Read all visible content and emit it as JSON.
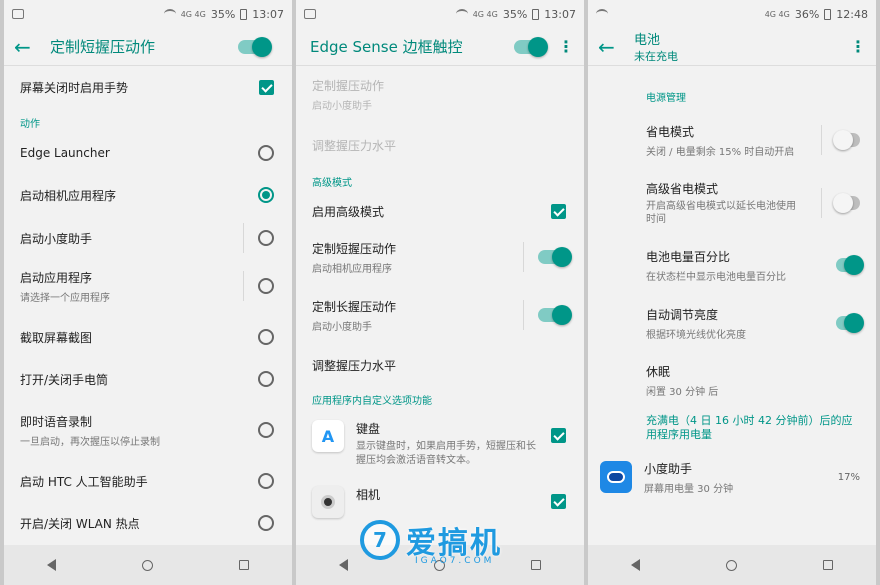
{
  "colors": {
    "accent": "#009688",
    "toggle_track": "#80cbc4",
    "watermark": "#1f9ae0"
  },
  "p1": {
    "status": {
      "battery": "35%",
      "time": "13:07",
      "signal": "4G 4G"
    },
    "title": "定制短握压动作",
    "gesture_screen_off": "屏幕关闭时启用手势",
    "section_actions": "动作",
    "options": [
      {
        "label": "Edge Launcher",
        "sub": ""
      },
      {
        "label": "启动相机应用程序",
        "sub": ""
      },
      {
        "label": "启动小度助手",
        "sub": ""
      },
      {
        "label": "启动应用程序",
        "sub": "请选择一个应用程序"
      },
      {
        "label": "截取屏幕截图",
        "sub": ""
      },
      {
        "label": "打开/关闭手电筒",
        "sub": ""
      },
      {
        "label": "即时语音录制",
        "sub": "一旦启动，再次握压以停止录制"
      },
      {
        "label": "启动 HTC 人工智能助手",
        "sub": ""
      },
      {
        "label": "开启/关闭 WLAN 热点",
        "sub": ""
      }
    ]
  },
  "p2": {
    "status": {
      "battery": "35%",
      "time": "13:07",
      "signal": "4G 4G"
    },
    "title": "Edge Sense 边框触控",
    "disabled1": {
      "label": "定制握压动作",
      "sub": "启动小度助手"
    },
    "disabled2": {
      "label": "调整握压力水平"
    },
    "section_advanced": "高级模式",
    "enable_advanced": "启用高级模式",
    "short": {
      "label": "定制短握压动作",
      "sub": "启动相机应用程序"
    },
    "long": {
      "label": "定制长握压动作",
      "sub": "启动小度助手"
    },
    "adjust": "调整握压力水平",
    "section_inapp": "应用程序内自定义选项功能",
    "keyboard": {
      "label": "键盘",
      "sub": "显示键盘时，如果启用手势，短握压和长握压均会激活语音转文本。",
      "icon": "A"
    },
    "camera": {
      "label": "相机"
    }
  },
  "p3": {
    "status": {
      "battery": "36%",
      "time": "12:48",
      "signal": "4G 4G"
    },
    "title": "电池",
    "subtitle": "未在充电",
    "section_power": "电源管理",
    "saver": {
      "label": "省电模式",
      "sub": "关闭 / 电量剩余 15% 时自动开启"
    },
    "adv_saver": {
      "label": "高级省电模式",
      "sub": "开启高级省电模式以延长电池使用时间"
    },
    "percent": {
      "label": "电池电量百分比",
      "sub": "在状态栏中显示电池电量百分比"
    },
    "brightness": {
      "label": "自动调节亮度",
      "sub": "根据环境光线优化亮度"
    },
    "sleep": {
      "label": "休眠",
      "sub": "闲置 30 分钟 后"
    },
    "usage_header": "充满电（4 日 16 小时 42 分钟前）后的应用程序用电量",
    "app": {
      "label": "小度助手",
      "sub": "屏幕用电量 30 分钟",
      "pct": "17%"
    }
  },
  "watermark": {
    "brand": "爱搞机",
    "sub": "IGAO7.COM",
    "logo": "7"
  }
}
